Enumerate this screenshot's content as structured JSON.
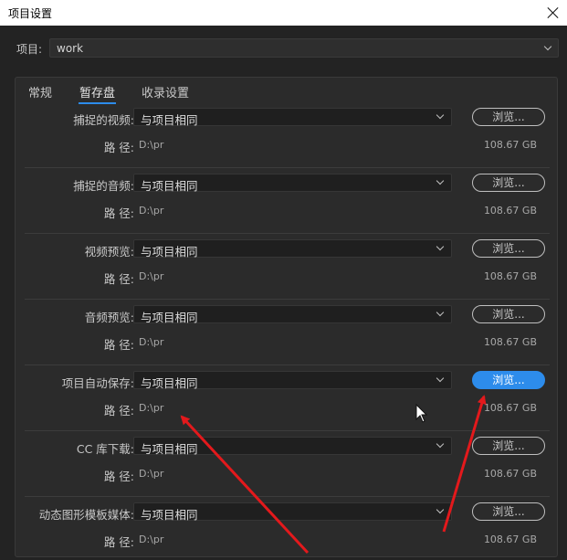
{
  "window": {
    "title": "项目设置"
  },
  "project": {
    "label": "项目:",
    "value": "work"
  },
  "tabs": [
    {
      "label": "常规"
    },
    {
      "label": "暂存盘"
    },
    {
      "label": "收录设置"
    }
  ],
  "active_tab": "暂存盘",
  "path_label": "路 径:",
  "browse_label": "浏览...",
  "rows": [
    {
      "label": "捕捉的视频:",
      "select": "与项目相同",
      "path": "D:\\pr",
      "size": "108.67 GB"
    },
    {
      "label": "捕捉的音频:",
      "select": "与项目相同",
      "path": "D:\\pr",
      "size": "108.67 GB"
    },
    {
      "label": "视频预览:",
      "select": "与项目相同",
      "path": "D:\\pr",
      "size": "108.67 GB"
    },
    {
      "label": "音频预览:",
      "select": "与项目相同",
      "path": "D:\\pr",
      "size": "108.67 GB"
    },
    {
      "label": "项目自动保存:",
      "select": "与项目相同",
      "path": "D:\\pr",
      "size": "108.67 GB"
    },
    {
      "label": "CC 库下载:",
      "select": "与项目相同",
      "path": "D:\\pr",
      "size": "108.67 GB"
    },
    {
      "label": "动态图形模板媒体:",
      "select": "与项目相同",
      "path": "D:\\pr",
      "size": "108.67 GB"
    }
  ],
  "colors": {
    "accent": "#2d8ceb",
    "annotation_arrow": "#e3191c",
    "background": "#232323"
  }
}
